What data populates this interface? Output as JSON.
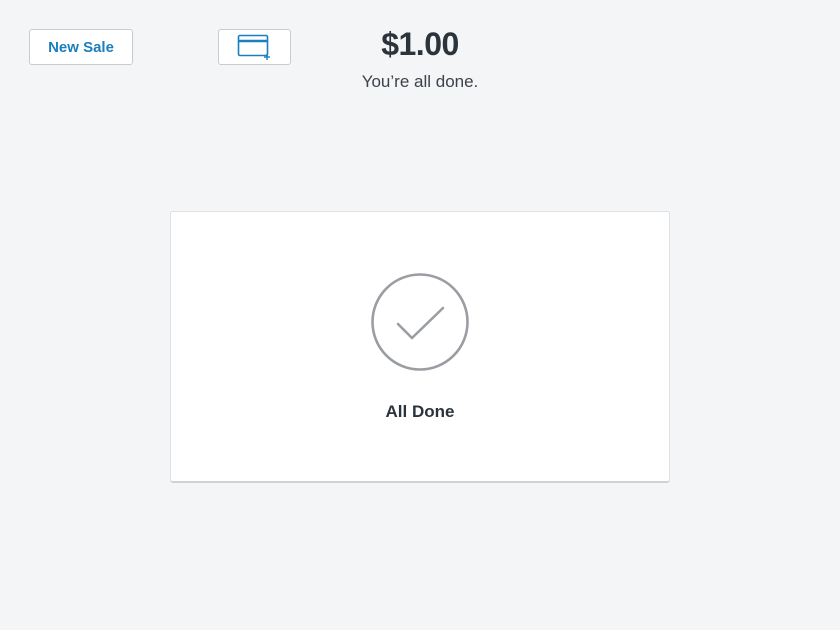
{
  "header": {
    "new_sale_label": "New Sale",
    "card_button_icon": "credit-card-add-icon",
    "amount": "$1.00",
    "subtitle": "You’re all done."
  },
  "status_card": {
    "icon": "checkmark-circle-icon",
    "label": "All Done"
  },
  "colors": {
    "accent": "#1b7fbe",
    "background": "#f4f5f7",
    "text": "#2b333b",
    "check": "#9a9ea2"
  }
}
